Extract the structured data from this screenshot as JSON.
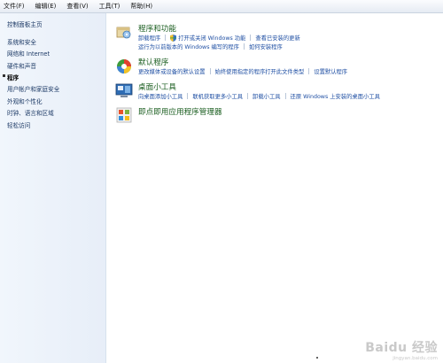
{
  "menubar": {
    "items": [
      "文件(F)",
      "编辑(E)",
      "查看(V)",
      "工具(T)",
      "帮助(H)"
    ]
  },
  "sidebar": {
    "home": "控制面板主页",
    "items": [
      {
        "label": "系统和安全",
        "current": false
      },
      {
        "label": "网络和 Internet",
        "current": false
      },
      {
        "label": "硬件和声音",
        "current": false
      },
      {
        "label": "程序",
        "current": true
      },
      {
        "label": "用户帐户和家庭安全",
        "current": false
      },
      {
        "label": "外观和个性化",
        "current": false
      },
      {
        "label": "时钟、语言和区域",
        "current": false
      },
      {
        "label": "轻松访问",
        "current": false
      }
    ]
  },
  "categories": [
    {
      "title": "程序和功能",
      "icon": "programs-features-icon",
      "links_row1": [
        "卸载程序",
        "打开或关闭 Windows 功能",
        "查看已安装的更新"
      ],
      "links_row2": [
        "运行为以前版本的 Windows 编写的程序",
        "如何安装程序"
      ]
    },
    {
      "title": "默认程序",
      "icon": "default-programs-icon",
      "links_row1": [
        "更改媒体或设备的默认设置",
        "始终使用指定的程序打开此文件类型",
        "设置默认程序"
      ]
    },
    {
      "title": "桌面小工具",
      "icon": "desktop-gadgets-icon",
      "links_row1": [
        "向桌面添加小工具",
        "联机获取更多小工具",
        "卸载小工具",
        "还原 Windows 上安装的桌面小工具"
      ]
    },
    {
      "title": "即点即用应用程序管理器",
      "icon": "click-to-run-icon"
    }
  ],
  "watermark": {
    "brand": "Baidu 经验",
    "url": "jingyan.baidu.com"
  }
}
